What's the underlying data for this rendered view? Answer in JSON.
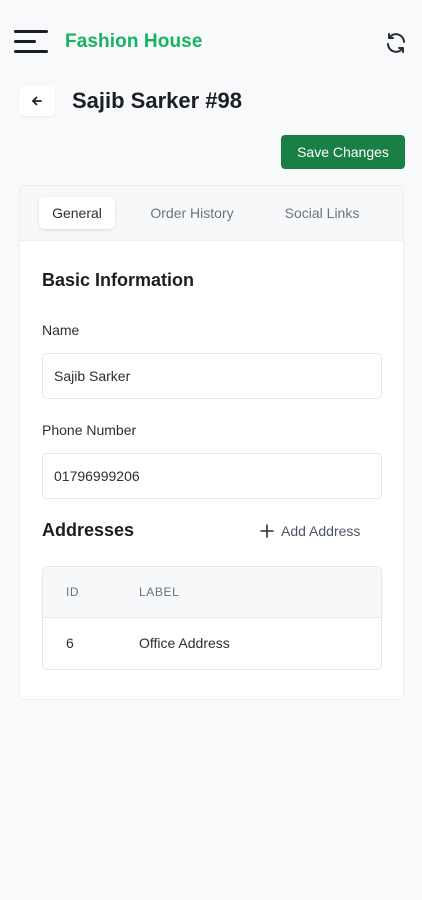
{
  "header": {
    "brand": "Fashion House",
    "menu_icon": "hamburger-menu-icon",
    "refresh_icon": "refresh-icon",
    "brand_color": "#16b364"
  },
  "page": {
    "title": "Sajib Sarker #98",
    "back_icon": "arrow-left-icon",
    "save_label": "Save Changes",
    "save_color": "#1a7f45"
  },
  "tabs": [
    {
      "label": "General",
      "active": true
    },
    {
      "label": "Order History",
      "active": false
    },
    {
      "label": "Social Links",
      "active": false
    }
  ],
  "basic_info": {
    "title": "Basic Information",
    "name_label": "Name",
    "name_value": "Sajib Sarker",
    "phone_label": "Phone Number",
    "phone_value": "01796999206"
  },
  "addresses": {
    "title": "Addresses",
    "add_label": "Add Address",
    "add_icon": "plus-icon",
    "columns": [
      "ID",
      "LABEL"
    ],
    "rows": [
      {
        "id": "6",
        "label": "Office Address"
      }
    ]
  }
}
